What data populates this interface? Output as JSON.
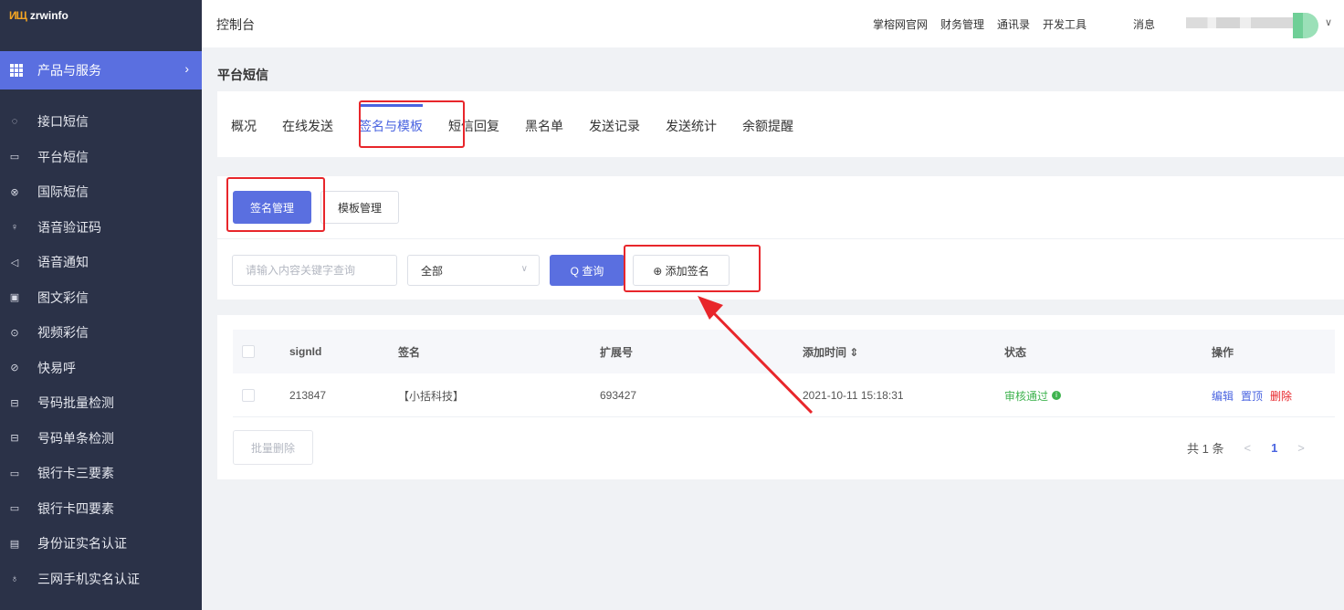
{
  "brand": {
    "mark": "ИЩ",
    "name": "zrwinfo"
  },
  "sidebar": {
    "section_label": "产品与服务",
    "items": [
      {
        "label": "接口短信",
        "icon": "chat-bubble-icon"
      },
      {
        "label": "平台短信",
        "icon": "message-square-icon"
      },
      {
        "label": "国际短信",
        "icon": "globe-icon"
      },
      {
        "label": "语音验证码",
        "icon": "microphone-icon"
      },
      {
        "label": "语音通知",
        "icon": "speaker-icon"
      },
      {
        "label": "图文彩信",
        "icon": "image-icon"
      },
      {
        "label": "视频彩信",
        "icon": "play-circle-icon"
      },
      {
        "label": "快易呼",
        "icon": "phone-circle-icon"
      },
      {
        "label": "号码批量检测",
        "icon": "scan-icon"
      },
      {
        "label": "号码单条检测",
        "icon": "scan-single-icon"
      },
      {
        "label": "银行卡三要素",
        "icon": "card-icon"
      },
      {
        "label": "银行卡四要素",
        "icon": "card-icon"
      },
      {
        "label": "身份证实名认证",
        "icon": "id-card-icon"
      },
      {
        "label": "三网手机实名认证",
        "icon": "user-icon"
      }
    ]
  },
  "topbar": {
    "title": "控制台",
    "links": [
      "掌榕网官网",
      "财务管理",
      "通讯录",
      "开发工具"
    ],
    "messages": "消息"
  },
  "page": {
    "title": "平台短信",
    "tabs": [
      "概况",
      "在线发送",
      "签名与模板",
      "短信回复",
      "黑名单",
      "发送记录",
      "发送统计",
      "余额提醒"
    ],
    "active_tab": "签名与模板"
  },
  "subtabs": {
    "sign": "签名管理",
    "template": "模板管理"
  },
  "filter": {
    "search_placeholder": "请输入内容关键字查询",
    "select_value": "全部",
    "query_label": "Q 查询",
    "add_label": "⊕ 添加签名"
  },
  "table": {
    "headers": {
      "id": "signId",
      "sign": "签名",
      "ext": "扩展号",
      "time": "添加时间 ⇕",
      "status": "状态",
      "ops": "操作"
    },
    "rows": [
      {
        "id": "213847",
        "sign": "【小括科技】",
        "ext": "693427",
        "time": "2021-10-11 15:18:31",
        "status": "审核通过",
        "ops": [
          "编辑",
          "置顶",
          "删除"
        ]
      }
    ]
  },
  "footer": {
    "batch_delete": "批量删除",
    "total": "共 1 条",
    "prev": "<",
    "page": "1",
    "next": ">"
  },
  "colors": {
    "accent": "#5a6fe0",
    "sidebar": "#2b3248",
    "annotation": "#e8262b",
    "success": "#3fb34f"
  }
}
